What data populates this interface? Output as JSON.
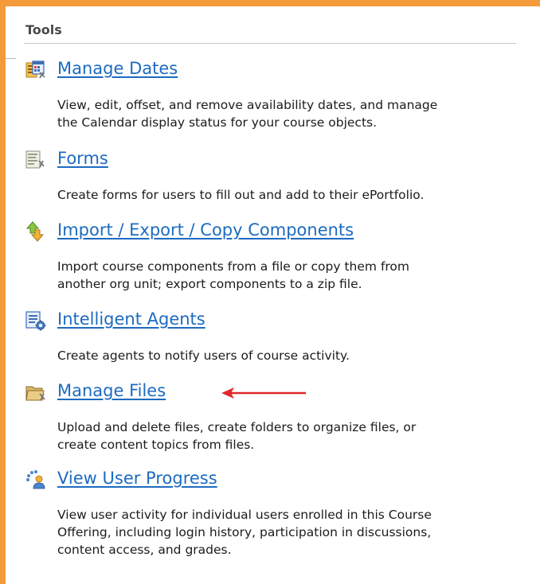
{
  "theme": {
    "frame_color": "#f59a3b",
    "link_color": "#1d6bc0",
    "annotation_arrow_color": "#e0262b"
  },
  "panel": {
    "title": "Tools"
  },
  "tools": [
    {
      "label": "Manage Dates",
      "icon": "calendar-tool-icon",
      "description": [
        "View, edit, offset, and remove availability dates, and manage",
        "the Calendar display status for your course objects."
      ]
    },
    {
      "label": "Forms",
      "icon": "form-tool-icon",
      "description": [
        "Create forms for users to fill out and add to their ePortfolio."
      ]
    },
    {
      "label": "Import / Export / Copy Components",
      "icon": "import-export-arrows-icon",
      "description": [
        "Import course components from a file or copy them from",
        "another org unit; export components to a zip file."
      ]
    },
    {
      "label": "Intelligent Agents",
      "icon": "agent-gear-icon",
      "description": [
        "Create agents to notify users of course activity."
      ]
    },
    {
      "label": "Manage Files",
      "icon": "folder-tool-icon",
      "annotated": true,
      "description": [
        "Upload and delete files, create folders to organize files, or",
        "create content topics from files."
      ]
    },
    {
      "label": "View User Progress",
      "icon": "user-progress-icon",
      "description": [
        "View user activity for individual users enrolled in this Course",
        "Offering, including login history, participation in discussions,",
        "content access, and grades."
      ]
    }
  ]
}
